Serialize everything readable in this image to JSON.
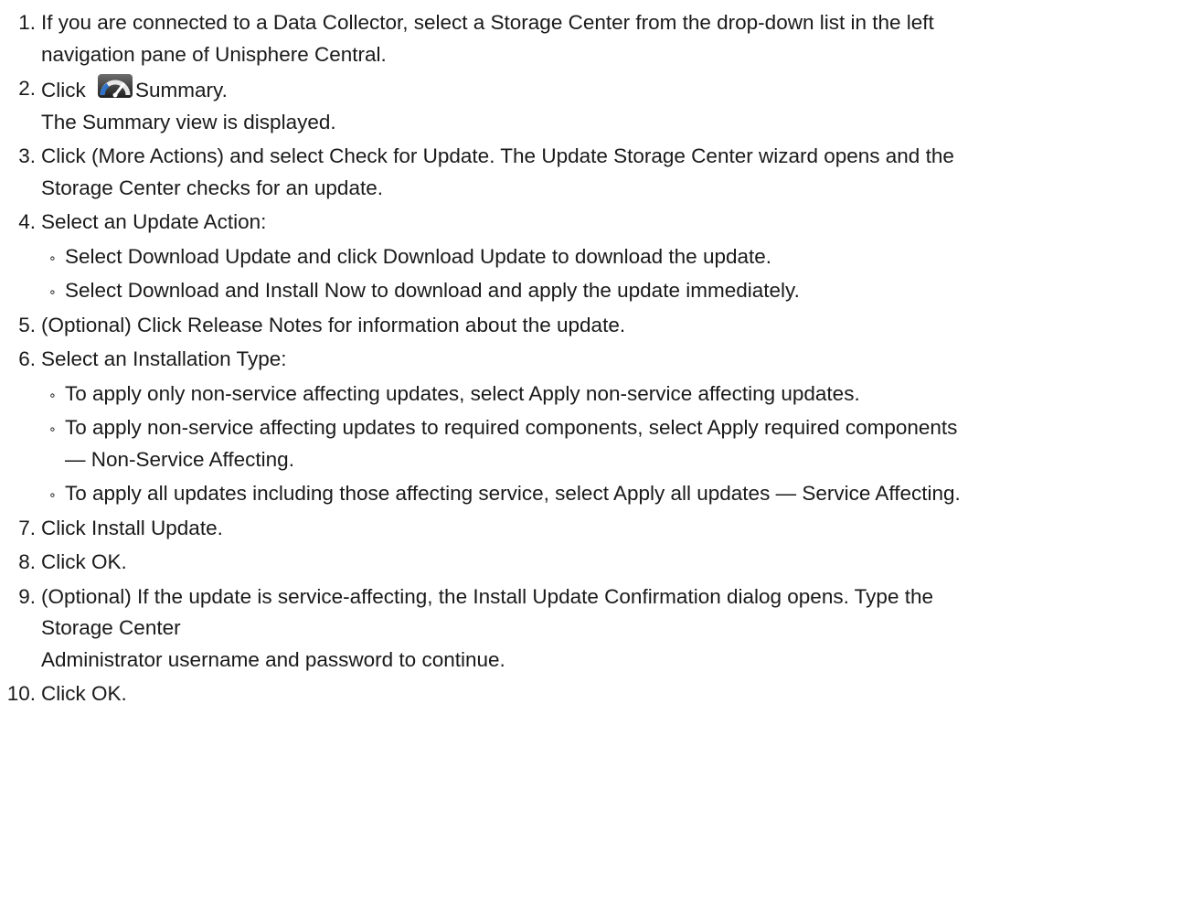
{
  "steps": [
    {
      "num": "1.",
      "lines": [
        "If you are connected to a Data Collector, select a Storage Center from the drop-down list in the left",
        "navigation pane of Unisphere Central."
      ]
    },
    {
      "num": "2.",
      "prefix": "Click ",
      "icon": "summary-gauge-icon",
      "suffix": "Summary.",
      "lines": [
        "The Summary view is displayed."
      ]
    },
    {
      "num": "3.",
      "lines": [
        "Click (More Actions) and select Check for Update. The Update Storage Center wizard opens and the",
        "Storage Center checks for an update."
      ]
    },
    {
      "num": "4.",
      "lines": [
        "Select an Update Action:"
      ],
      "sub": [
        [
          "Select Download Update and click Download Update to download the update."
        ],
        [
          "Select Download and Install Now to download and apply the update immediately."
        ]
      ]
    },
    {
      "num": "5.",
      "lines": [
        "(Optional) Click Release Notes for information about the update."
      ]
    },
    {
      "num": "6.",
      "lines": [
        "Select an Installation Type:"
      ],
      "sub": [
        [
          "To apply only non-service affecting updates, select Apply non-service affecting updates."
        ],
        [
          "To apply non-service affecting updates to required components, select Apply required components",
          "— Non-Service Affecting."
        ],
        [
          "To apply all updates including those affecting service, select Apply all updates — Service Affecting."
        ]
      ]
    },
    {
      "num": "7.",
      "lines": [
        "Click Install Update."
      ]
    },
    {
      "num": "8.",
      "lines": [
        "Click OK."
      ]
    },
    {
      "num": "9.",
      "lines": [
        "(Optional) If the update is service-affecting, the Install Update Confirmation dialog opens. Type the",
        "Storage Center",
        "Administrator username and password to continue."
      ]
    },
    {
      "num": "10.",
      "lines": [
        "Click OK."
      ]
    }
  ],
  "bullet_char": "∘"
}
